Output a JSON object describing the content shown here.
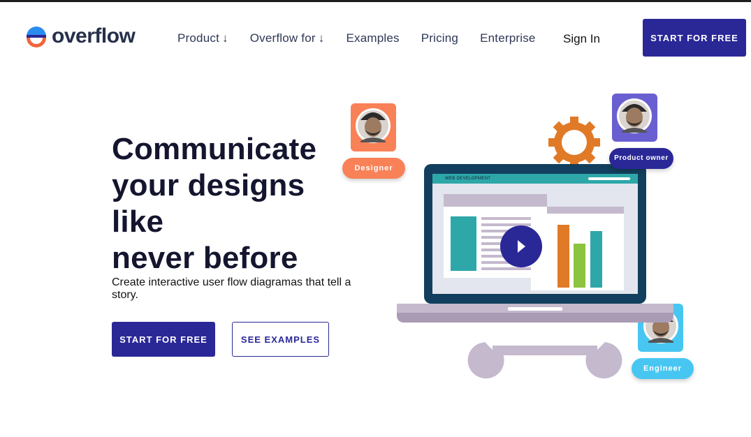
{
  "brand": {
    "name": "overflow",
    "icon": "overflow-logo-icon",
    "colors": {
      "blue": "#2b8cf0",
      "orange": "#f2653a",
      "navy": "#2a2897"
    }
  },
  "nav": {
    "items": [
      {
        "label": "Product",
        "arrow": "↓"
      },
      {
        "label": "Overflow for",
        "arrow": "↓"
      },
      {
        "label": "Examples",
        "arrow": ""
      },
      {
        "label": "Pricing",
        "arrow": ""
      },
      {
        "label": "Enterprise",
        "arrow": ""
      }
    ],
    "sign_in": "Sign In",
    "cta": "START FOR FREE"
  },
  "hero": {
    "headline_lines": [
      "Communicate",
      "your designs",
      "like",
      "never before"
    ],
    "subtext": "Create interactive user flow diagramas that tell a story.",
    "primary_cta": "START FOR FREE",
    "secondary_cta": "SEE EXAMPLES"
  },
  "illustration": {
    "screen_header": "WEB DEVELOPMENT",
    "roles": [
      {
        "label": "Designer",
        "color": "#f98157"
      },
      {
        "label": "Product owner",
        "color": "#6a5fd1"
      },
      {
        "label": "Engineer",
        "color": "#48c6f2"
      }
    ],
    "icons": [
      "gear-icon",
      "wrench-icon",
      "play-icon",
      "laptop-icon"
    ],
    "colors": {
      "laptop": "#123f5e",
      "teal": "#2ea7a9",
      "orange_bar": "#e17a27",
      "green_bar": "#8cc43f",
      "gear": "#e17a27"
    }
  }
}
